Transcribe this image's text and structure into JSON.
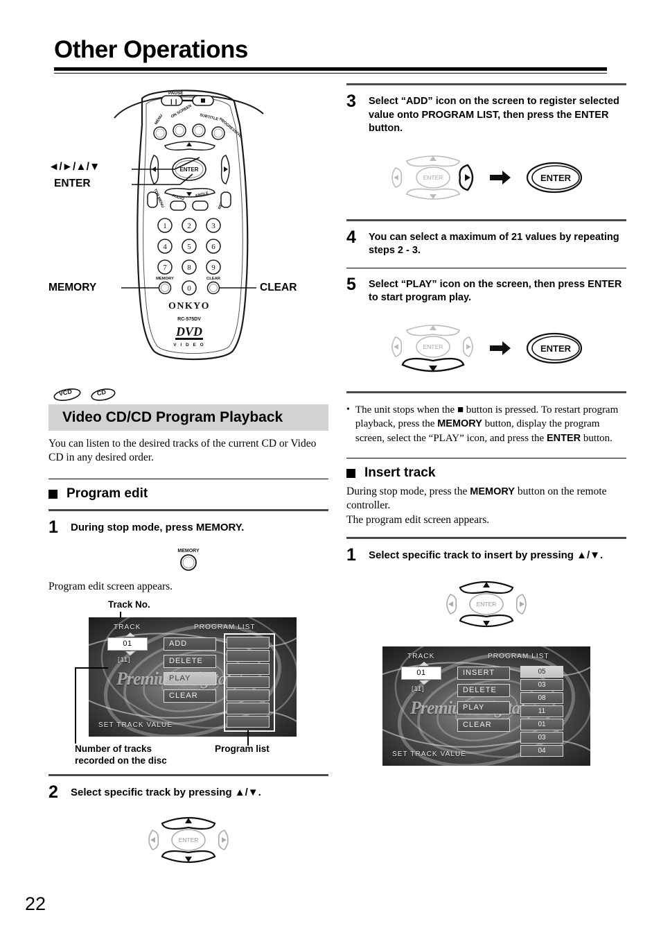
{
  "page": {
    "title": "Other Operations",
    "number": "22"
  },
  "remote": {
    "brand": "ONKYO",
    "model": "RC-575DV",
    "logo_top": "DVD",
    "logo_bottom": "V I D E O",
    "pause_label": "PAUSE",
    "row_buttons": [
      "MENU",
      "ON SCREEN",
      "SUBTITLE",
      "PROGRESSIVE"
    ],
    "mid_buttons": [
      "TOP MENU",
      "AUDIO",
      "ANGLE",
      "RETURN"
    ],
    "enter_label": "ENTER",
    "memory_label": "MEMORY",
    "clear_label": "CLEAR",
    "keypad": [
      "1",
      "2",
      "3",
      "4",
      "5",
      "6",
      "7",
      "8",
      "9",
      "0"
    ],
    "callouts": {
      "dpad": "◄/►/▲/▼",
      "enter": "ENTER",
      "memory": "MEMORY",
      "clear": "CLEAR"
    }
  },
  "left_column": {
    "disc_icons": [
      "VCD",
      "CD"
    ],
    "section_title": "Video CD/CD Program Playback",
    "intro": "You can listen to the desired tracks of the current CD or Video CD in any desired order.",
    "subsection": "Program edit",
    "step1": {
      "num": "1",
      "text": "During stop mode, press MEMORY.",
      "button_label": "MEMORY",
      "note": "Program edit screen appears."
    },
    "callout_track_no": "Track No.",
    "callout_num_tracks": "Number of tracks\nrecorded on the disc",
    "callout_program_list": "Program list",
    "step2": {
      "num": "2",
      "text": "Select specific track by pressing ▲/▼."
    }
  },
  "right_column": {
    "step3": {
      "num": "3",
      "text": "Select “ADD” icon on the screen to register selected value onto PROGRAM LIST, then press the ENTER button.",
      "enter_label": "ENTER"
    },
    "step4": {
      "num": "4",
      "text": "You can select a maximum of 21 values by repeating steps 2 - 3."
    },
    "step5": {
      "num": "5",
      "text": "Select “PLAY” icon on the screen, then press ENTER to start program play.",
      "enter_label": "ENTER"
    },
    "bullet_note": {
      "prefix": "The unit stops when the",
      "square": "■",
      "mid1": "button is pressed. To restart program playback, press the",
      "bold1": "MEMORY",
      "mid2": "button, display the program screen, select the “PLAY” icon, and press the",
      "bold2": "ENTER",
      "suffix": "button."
    },
    "insert_track": {
      "heading": "Insert track",
      "line1_a": "During stop mode, press the",
      "line1_b": "MEMORY",
      "line1_c": "button on the remote controller.",
      "line2": "The program edit screen appears."
    },
    "step1": {
      "num": "1",
      "text": "Select specific track to insert by pressing ▲/▼."
    }
  },
  "osd_left": {
    "track_label": "TRACK",
    "track_value": "01",
    "track_count": "[11]",
    "program_list_label": "PROGRAM LIST",
    "buttons": [
      "ADD",
      "DELETE",
      "PLAY",
      "CLEAR"
    ],
    "selected_button": "PLAY",
    "program_items": [
      "",
      "",
      "",
      "",
      "",
      "",
      ""
    ],
    "selected_item_index": -1,
    "footer": "SET TRACK VALUE",
    "watermark": "Premium Digital"
  },
  "osd_right": {
    "track_label": "TRACK",
    "track_value": "01",
    "track_count": "[11]",
    "program_list_label": "PROGRAM LIST",
    "buttons": [
      "INSERT",
      "DELETE",
      "PLAY",
      "CLEAR"
    ],
    "selected_button": "",
    "program_items": [
      "05",
      "03",
      "08",
      "11",
      "01",
      "03",
      "04"
    ],
    "selected_item_index": 0,
    "footer": "SET TRACK VALUE",
    "watermark": "Premium Digital"
  },
  "colors": {
    "section_bar_bg": "#d2d2d2",
    "rule": "#4a4a4a",
    "osd_bg": "#2a2a2a"
  }
}
